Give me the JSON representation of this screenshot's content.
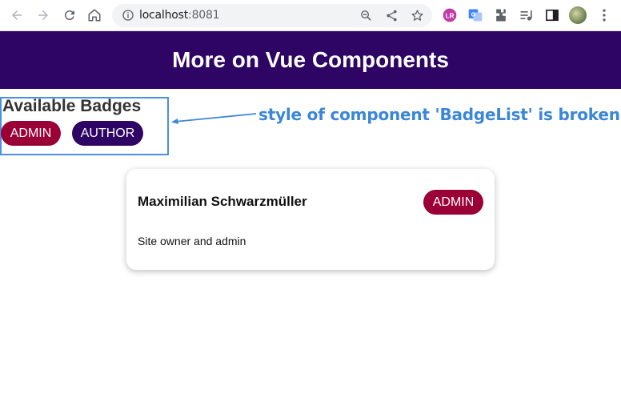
{
  "browser": {
    "url_host": "localhost",
    "url_port": ":8081"
  },
  "page": {
    "title": "More on Vue Components",
    "badge_list": {
      "heading": "Available Badges",
      "badges": [
        {
          "label": "ADMIN",
          "color": "#9a0035"
        },
        {
          "label": "AUTHOR",
          "color": "#2e0564"
        }
      ]
    },
    "annotation": "style of component 'BadgeList' is broken",
    "user_card": {
      "name": "Maximilian Schwarzmüller",
      "badge": "ADMIN",
      "description": "Site owner and admin"
    }
  },
  "colors": {
    "header_bg": "#2e0564",
    "admin": "#9a0035",
    "author": "#2e0564",
    "annotation": "#3a86d8"
  }
}
